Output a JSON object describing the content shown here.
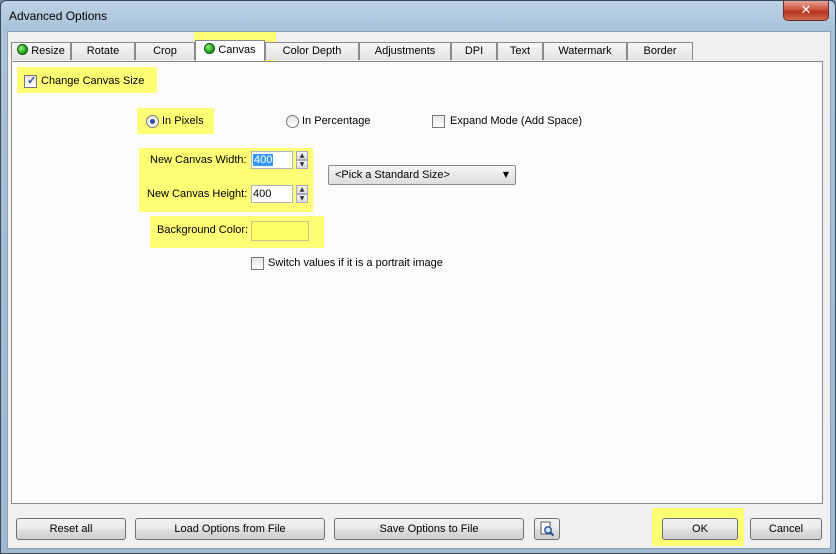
{
  "window": {
    "title": "Advanced Options",
    "close_symbol": "✕"
  },
  "tabs": [
    {
      "label": "Resize",
      "status": "active-indicator"
    },
    {
      "label": "Rotate"
    },
    {
      "label": "Crop"
    },
    {
      "label": "Canvas",
      "status": "active-indicator",
      "selected": true
    },
    {
      "label": "Color Depth"
    },
    {
      "label": "Adjustments"
    },
    {
      "label": "DPI"
    },
    {
      "label": "Text"
    },
    {
      "label": "Watermark"
    },
    {
      "label": "Border"
    }
  ],
  "canvas": {
    "change_canvas_size": {
      "label": "Change Canvas Size",
      "checked": true
    },
    "units": {
      "in_pixels": {
        "label": "In Pixels",
        "selected": true
      },
      "in_percentage": {
        "label": "In Percentage",
        "selected": false
      }
    },
    "expand_mode": {
      "label": "Expand Mode (Add Space)",
      "checked": false
    },
    "width": {
      "label": "New Canvas Width:",
      "value": "400"
    },
    "height": {
      "label": "New Canvas Height:",
      "value": "400"
    },
    "standard_size": {
      "selected": "<Pick a Standard Size>"
    },
    "background_color": {
      "label": "Background Color:",
      "value": "",
      "color": "#ffff66"
    },
    "switch_portrait": {
      "label": "Switch values if it is a portrait image",
      "checked": false
    }
  },
  "buttons": {
    "reset_all": "Reset all",
    "load": "Load Options from File",
    "save": "Save Options to File",
    "ok": "OK",
    "cancel": "Cancel"
  },
  "colors": {
    "highlight": "#ffff66",
    "status_dot": "#1da318"
  }
}
